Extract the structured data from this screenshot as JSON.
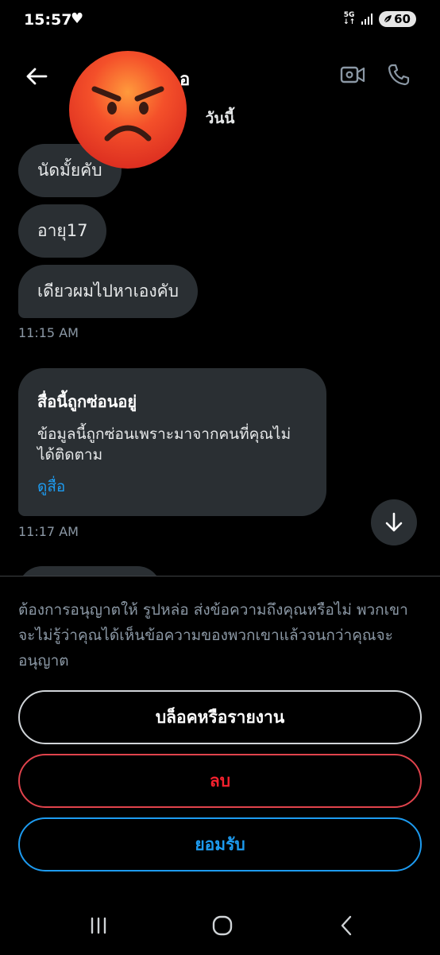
{
  "status_bar": {
    "time": "15:57",
    "network_top": "5G",
    "network_bottom": "↓↑",
    "battery": "60"
  },
  "header": {
    "name_visible": "อ",
    "avatar_icon": "angry-face-emoji-icon",
    "back_icon": "back-arrow-icon",
    "video_icon": "video-call-icon",
    "call_icon": "phone-icon"
  },
  "date_separator": "วันนี้",
  "messages": [
    {
      "text": "นัดมั้ยคับ"
    },
    {
      "text": "อายุ17"
    },
    {
      "text": "เดียวผมไปหาเองคับ"
    }
  ],
  "time_1": "11:15 AM",
  "hidden_media": {
    "title": "สื่อนี้ถูกซ่อนอยู่",
    "body": "ข้อมูลนี้ถูกซ่อนเพราะมาจากคนที่คุณไม่ได้ติดตาม",
    "link": "ดูสื่อ"
  },
  "time_2": "11:17 AM",
  "request_sheet": {
    "text": "ต้องการอนุญาตให้ รูปหล่อ ส่งข้อความถึงคุณหรือไม่ พวกเขาจะไม่รู้ว่าคุณได้เห็นข้อความของพวกเขาแล้วจนกว่าคุณจะอนุญาต",
    "block_report": "บล็อคหรือรายงาน",
    "delete": "ลบ",
    "accept": "ยอมรับ"
  },
  "colors": {
    "background": "#000000",
    "bubble": "#2a2f33",
    "accent_blue": "#1d9bf0",
    "danger_red": "#f4212e",
    "muted_text": "#8b98a5"
  }
}
